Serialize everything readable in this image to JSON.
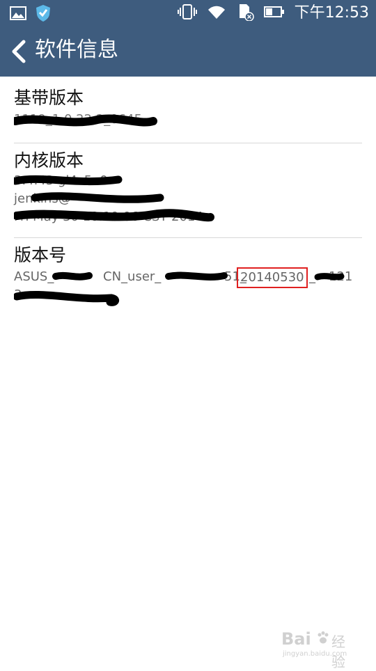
{
  "status_bar": {
    "icons_left": [
      "image-icon",
      "shield-icon"
    ],
    "icons_right": [
      "vibrate-icon",
      "wifi-icon",
      "sd-card-icon",
      "battery-icon"
    ],
    "time": "下午12:53"
  },
  "app_bar": {
    "title": "软件信息",
    "back_icon": "chevron-left-icon"
  },
  "sections": [
    {
      "title": "基带版本",
      "lines": [
        "1119_1.0.22.2_0645"
      ]
    },
    {
      "title": "内核版本",
      "lines": [
        "3.4.43 gl4c5a0",
        "jenkins@",
        "Fri May 30 10:10:06 CST 2014"
      ]
    },
    {
      "title": "版本号",
      "lines": [
        "ASUS_",
        "CN_user_",
        "51_",
        "20140530",
        "_",
        "121"
      ],
      "highlight": "20140530",
      "line2": "3"
    }
  ],
  "watermark": {
    "brand": "Bai",
    "brand2": "经验",
    "url": "jingyan.baidu.com"
  },
  "colors": {
    "bar": "#3e5c7e",
    "highlight_box": "#e02020",
    "redaction": "#000000"
  }
}
